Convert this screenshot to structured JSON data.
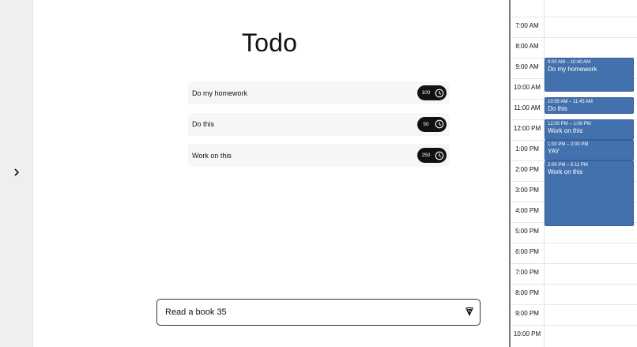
{
  "page": {
    "title": "Todo"
  },
  "sidebar": {
    "toggle_icon": "chevron-right-icon"
  },
  "todos": [
    {
      "text": "Do my homework",
      "minutes": "100"
    },
    {
      "text": "Do this",
      "minutes": "50"
    },
    {
      "text": "Work on this",
      "minutes": "250"
    }
  ],
  "new_todo": {
    "value": "Read a book 35",
    "submit_icon": "pizza-icon"
  },
  "calendar": {
    "hours": [
      "7:00 AM",
      "8:00 AM",
      "9:00 AM",
      "10:00 AM",
      "11:00 AM",
      "12:00 PM",
      "1:00 PM",
      "2:00 PM",
      "3:00 PM",
      "4:00 PM",
      "5:00 PM",
      "6:00 PM",
      "7:00 PM",
      "8:00 PM",
      "9:00 PM",
      "10:00 PM"
    ],
    "events": [
      {
        "time": "9:00 AM – 10:40 AM",
        "name": "Do my homework"
      },
      {
        "time": "10:55 AM – 11:45 AM",
        "name": "Do this"
      },
      {
        "time": "12:00 PM – 1:00 PM",
        "name": "Work on this"
      },
      {
        "time": "1:00 PM – 2:00 PM",
        "name": "YAY"
      },
      {
        "time": "2:00 PM – 5:11 PM",
        "name": "Work on this"
      }
    ],
    "event_color": "#4271ad"
  }
}
